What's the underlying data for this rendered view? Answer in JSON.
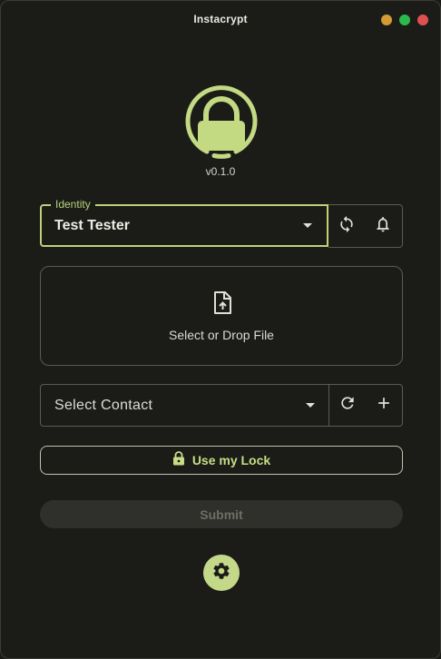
{
  "window": {
    "title": "Instacrypt",
    "traffic_lights": {
      "minimize_color": "#d39a36",
      "maximize_color": "#2db84d",
      "close_color": "#e05050"
    }
  },
  "header": {
    "logo_icon": "padlock-logo-icon",
    "version": "v0.1.0"
  },
  "identity": {
    "legend": "Identity",
    "selected": "Test Tester",
    "actions": [
      "sync-icon",
      "bell-icon"
    ]
  },
  "dropzone": {
    "icon": "file-upload-icon",
    "label": "Select or Drop File"
  },
  "contact": {
    "placeholder": "Select Contact",
    "actions": [
      "refresh-icon",
      "plus-icon"
    ]
  },
  "lock_button": {
    "icon": "lock-icon",
    "label": "Use my Lock"
  },
  "submit": {
    "label": "Submit",
    "enabled": false
  },
  "settings": {
    "icon": "gear-icon"
  },
  "colors": {
    "accent": "#bcd27a",
    "background": "#1b1c18",
    "border": "#5a5b55"
  }
}
